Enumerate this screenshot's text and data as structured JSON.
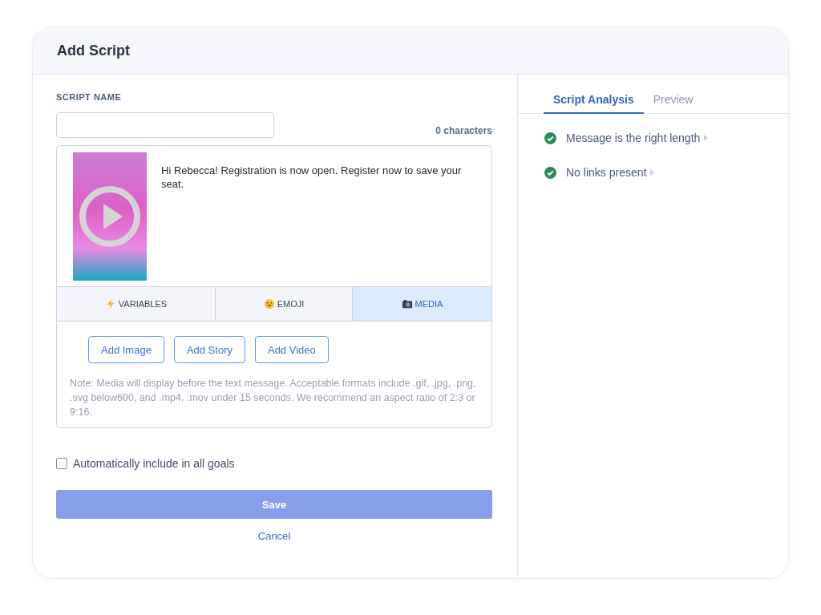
{
  "window": {
    "title": "Add Script"
  },
  "script_name": {
    "label": "SCRIPT NAME",
    "char_count": "0 characters"
  },
  "message": {
    "text": "Hi Rebecca! Registration is now open. Register now to save your seat."
  },
  "composer_tabs": [
    {
      "label": "VARIABLES",
      "kind": "bolt",
      "selected": false
    },
    {
      "label": "EMOJI",
      "kind": "smiley",
      "selected": false
    },
    {
      "label": "MEDIA",
      "kind": "camera",
      "selected": true
    }
  ],
  "media_buttons": [
    "Add Image",
    "Add Story",
    "Add Video"
  ],
  "note": "Note: Media will display before the text message. Acceptable formats include .gif, .jpg, .png, .svg below600, and .mp4, .mov under 15 seconds. We recommend an aspect ratio of 2:3 or 9:16.",
  "auto_include": {
    "label": "Automatically include in all goals",
    "checked": false
  },
  "save": {
    "label": "Save",
    "disabled": true
  },
  "cancel": "Cancel",
  "analysis_tabs": [
    {
      "label": "Script Analysis",
      "selected": true
    },
    {
      "label": "Preview",
      "selected": false
    }
  ],
  "checks": [
    {
      "text": "Message is the right length",
      "passed": true
    },
    {
      "text": "No links present",
      "passed": true
    }
  ]
}
